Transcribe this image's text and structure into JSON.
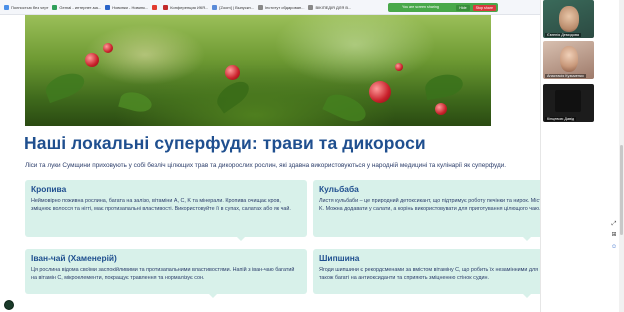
{
  "bookmarks": [
    {
      "label": "Полностью без черт",
      "color": "#4a8fe8"
    },
    {
      "label": "Gemal - интернет-ма...",
      "color": "#2f9f5a"
    },
    {
      "label": "Новинки - Новинк...",
      "color": "#2a64c8"
    },
    {
      "label": "",
      "color": "#e23b2e"
    },
    {
      "label": "Конференция ИКЯ...",
      "color": "#c22a2a"
    },
    {
      "label": "[Zoom] | Выпускн...",
      "color": "#5b8bd8"
    },
    {
      "label": "Інститут обдарован...",
      "color": "#888888"
    },
    {
      "label": "ВІКІПЕДІЯ ДЛЯ В...",
      "color": "#888888"
    }
  ],
  "sharebar": {
    "status": "You are screen sharing",
    "hide_label": "Hide",
    "stop_label": "Stop share"
  },
  "page": {
    "title": "Наші локальні суперфуди: трави та дикороси",
    "lead": "Ліси та луки Сумщини приховують у собі безліч цілющих трав та дикорослих рослин, які здавна використовуються у народній медицині та кулінарії як суперфуди."
  },
  "cards": [
    {
      "title": "Кропива",
      "text": "Неймовірно поживна рослина, багата на залізо, вітаміни A, C, K та мінерали. Кропива очищає кров, зміцнює волосся та нігті, має протизапальні властивості. Використовуйте її в супах, салатах або як чай."
    },
    {
      "title": "Кульбаба",
      "text": "Листя кульбаби – це природний детоксикант, що підтримує роботу печінки та нирок. Містить вітаміни A, C, K. Можна додавати у салати, а корінь використовувати для приготування цілющого чаю."
    },
    {
      "title": "Іван-чай (Хаменерій)",
      "text": "Ця рослина відома своїми заспокійливими та протизапальними властивостями. Напій з іван-чаю багатий на вітамін С, мікроелементи, покращує травлення та нормалізує сон."
    },
    {
      "title": "Шипшина",
      "text": "Ягоди шипшини є рекордсменами за вмістом вітаміну С, що робить їх незамінними для імунітету. Вони також багаті на антиоксиданти та сприяють зміцненню стінок судин."
    }
  ],
  "participants": [
    {
      "name": "Євгенія Демидова"
    },
    {
      "name": "Анастасія Кузьменко"
    },
    {
      "name": "Кінцевою Давід"
    }
  ],
  "colors": {
    "title": "#1f4f8f",
    "card_bg": "#d8f1ea",
    "share_green": "#49a84a",
    "stop_red": "#d9393e"
  }
}
